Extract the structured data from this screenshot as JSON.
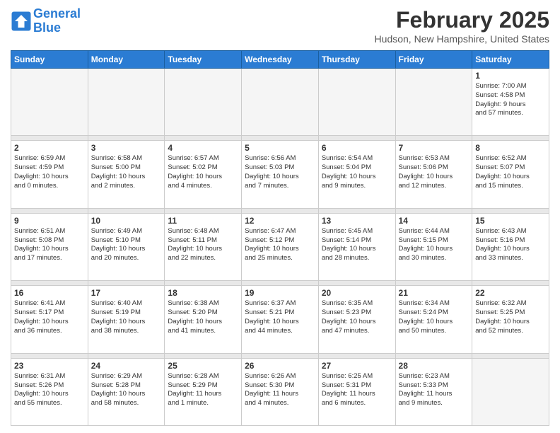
{
  "header": {
    "logo_line1": "General",
    "logo_line2": "Blue",
    "month": "February 2025",
    "location": "Hudson, New Hampshire, United States"
  },
  "days_of_week": [
    "Sunday",
    "Monday",
    "Tuesday",
    "Wednesday",
    "Thursday",
    "Friday",
    "Saturday"
  ],
  "weeks": [
    [
      {
        "num": "",
        "info": ""
      },
      {
        "num": "",
        "info": ""
      },
      {
        "num": "",
        "info": ""
      },
      {
        "num": "",
        "info": ""
      },
      {
        "num": "",
        "info": ""
      },
      {
        "num": "",
        "info": ""
      },
      {
        "num": "1",
        "info": "Sunrise: 7:00 AM\nSunset: 4:58 PM\nDaylight: 9 hours\nand 57 minutes."
      }
    ],
    [
      {
        "num": "2",
        "info": "Sunrise: 6:59 AM\nSunset: 4:59 PM\nDaylight: 10 hours\nand 0 minutes."
      },
      {
        "num": "3",
        "info": "Sunrise: 6:58 AM\nSunset: 5:00 PM\nDaylight: 10 hours\nand 2 minutes."
      },
      {
        "num": "4",
        "info": "Sunrise: 6:57 AM\nSunset: 5:02 PM\nDaylight: 10 hours\nand 4 minutes."
      },
      {
        "num": "5",
        "info": "Sunrise: 6:56 AM\nSunset: 5:03 PM\nDaylight: 10 hours\nand 7 minutes."
      },
      {
        "num": "6",
        "info": "Sunrise: 6:54 AM\nSunset: 5:04 PM\nDaylight: 10 hours\nand 9 minutes."
      },
      {
        "num": "7",
        "info": "Sunrise: 6:53 AM\nSunset: 5:06 PM\nDaylight: 10 hours\nand 12 minutes."
      },
      {
        "num": "8",
        "info": "Sunrise: 6:52 AM\nSunset: 5:07 PM\nDaylight: 10 hours\nand 15 minutes."
      }
    ],
    [
      {
        "num": "9",
        "info": "Sunrise: 6:51 AM\nSunset: 5:08 PM\nDaylight: 10 hours\nand 17 minutes."
      },
      {
        "num": "10",
        "info": "Sunrise: 6:49 AM\nSunset: 5:10 PM\nDaylight: 10 hours\nand 20 minutes."
      },
      {
        "num": "11",
        "info": "Sunrise: 6:48 AM\nSunset: 5:11 PM\nDaylight: 10 hours\nand 22 minutes."
      },
      {
        "num": "12",
        "info": "Sunrise: 6:47 AM\nSunset: 5:12 PM\nDaylight: 10 hours\nand 25 minutes."
      },
      {
        "num": "13",
        "info": "Sunrise: 6:45 AM\nSunset: 5:14 PM\nDaylight: 10 hours\nand 28 minutes."
      },
      {
        "num": "14",
        "info": "Sunrise: 6:44 AM\nSunset: 5:15 PM\nDaylight: 10 hours\nand 30 minutes."
      },
      {
        "num": "15",
        "info": "Sunrise: 6:43 AM\nSunset: 5:16 PM\nDaylight: 10 hours\nand 33 minutes."
      }
    ],
    [
      {
        "num": "16",
        "info": "Sunrise: 6:41 AM\nSunset: 5:17 PM\nDaylight: 10 hours\nand 36 minutes."
      },
      {
        "num": "17",
        "info": "Sunrise: 6:40 AM\nSunset: 5:19 PM\nDaylight: 10 hours\nand 38 minutes."
      },
      {
        "num": "18",
        "info": "Sunrise: 6:38 AM\nSunset: 5:20 PM\nDaylight: 10 hours\nand 41 minutes."
      },
      {
        "num": "19",
        "info": "Sunrise: 6:37 AM\nSunset: 5:21 PM\nDaylight: 10 hours\nand 44 minutes."
      },
      {
        "num": "20",
        "info": "Sunrise: 6:35 AM\nSunset: 5:23 PM\nDaylight: 10 hours\nand 47 minutes."
      },
      {
        "num": "21",
        "info": "Sunrise: 6:34 AM\nSunset: 5:24 PM\nDaylight: 10 hours\nand 50 minutes."
      },
      {
        "num": "22",
        "info": "Sunrise: 6:32 AM\nSunset: 5:25 PM\nDaylight: 10 hours\nand 52 minutes."
      }
    ],
    [
      {
        "num": "23",
        "info": "Sunrise: 6:31 AM\nSunset: 5:26 PM\nDaylight: 10 hours\nand 55 minutes."
      },
      {
        "num": "24",
        "info": "Sunrise: 6:29 AM\nSunset: 5:28 PM\nDaylight: 10 hours\nand 58 minutes."
      },
      {
        "num": "25",
        "info": "Sunrise: 6:28 AM\nSunset: 5:29 PM\nDaylight: 11 hours\nand 1 minute."
      },
      {
        "num": "26",
        "info": "Sunrise: 6:26 AM\nSunset: 5:30 PM\nDaylight: 11 hours\nand 4 minutes."
      },
      {
        "num": "27",
        "info": "Sunrise: 6:25 AM\nSunset: 5:31 PM\nDaylight: 11 hours\nand 6 minutes."
      },
      {
        "num": "28",
        "info": "Sunrise: 6:23 AM\nSunset: 5:33 PM\nDaylight: 11 hours\nand 9 minutes."
      },
      {
        "num": "",
        "info": ""
      }
    ]
  ]
}
